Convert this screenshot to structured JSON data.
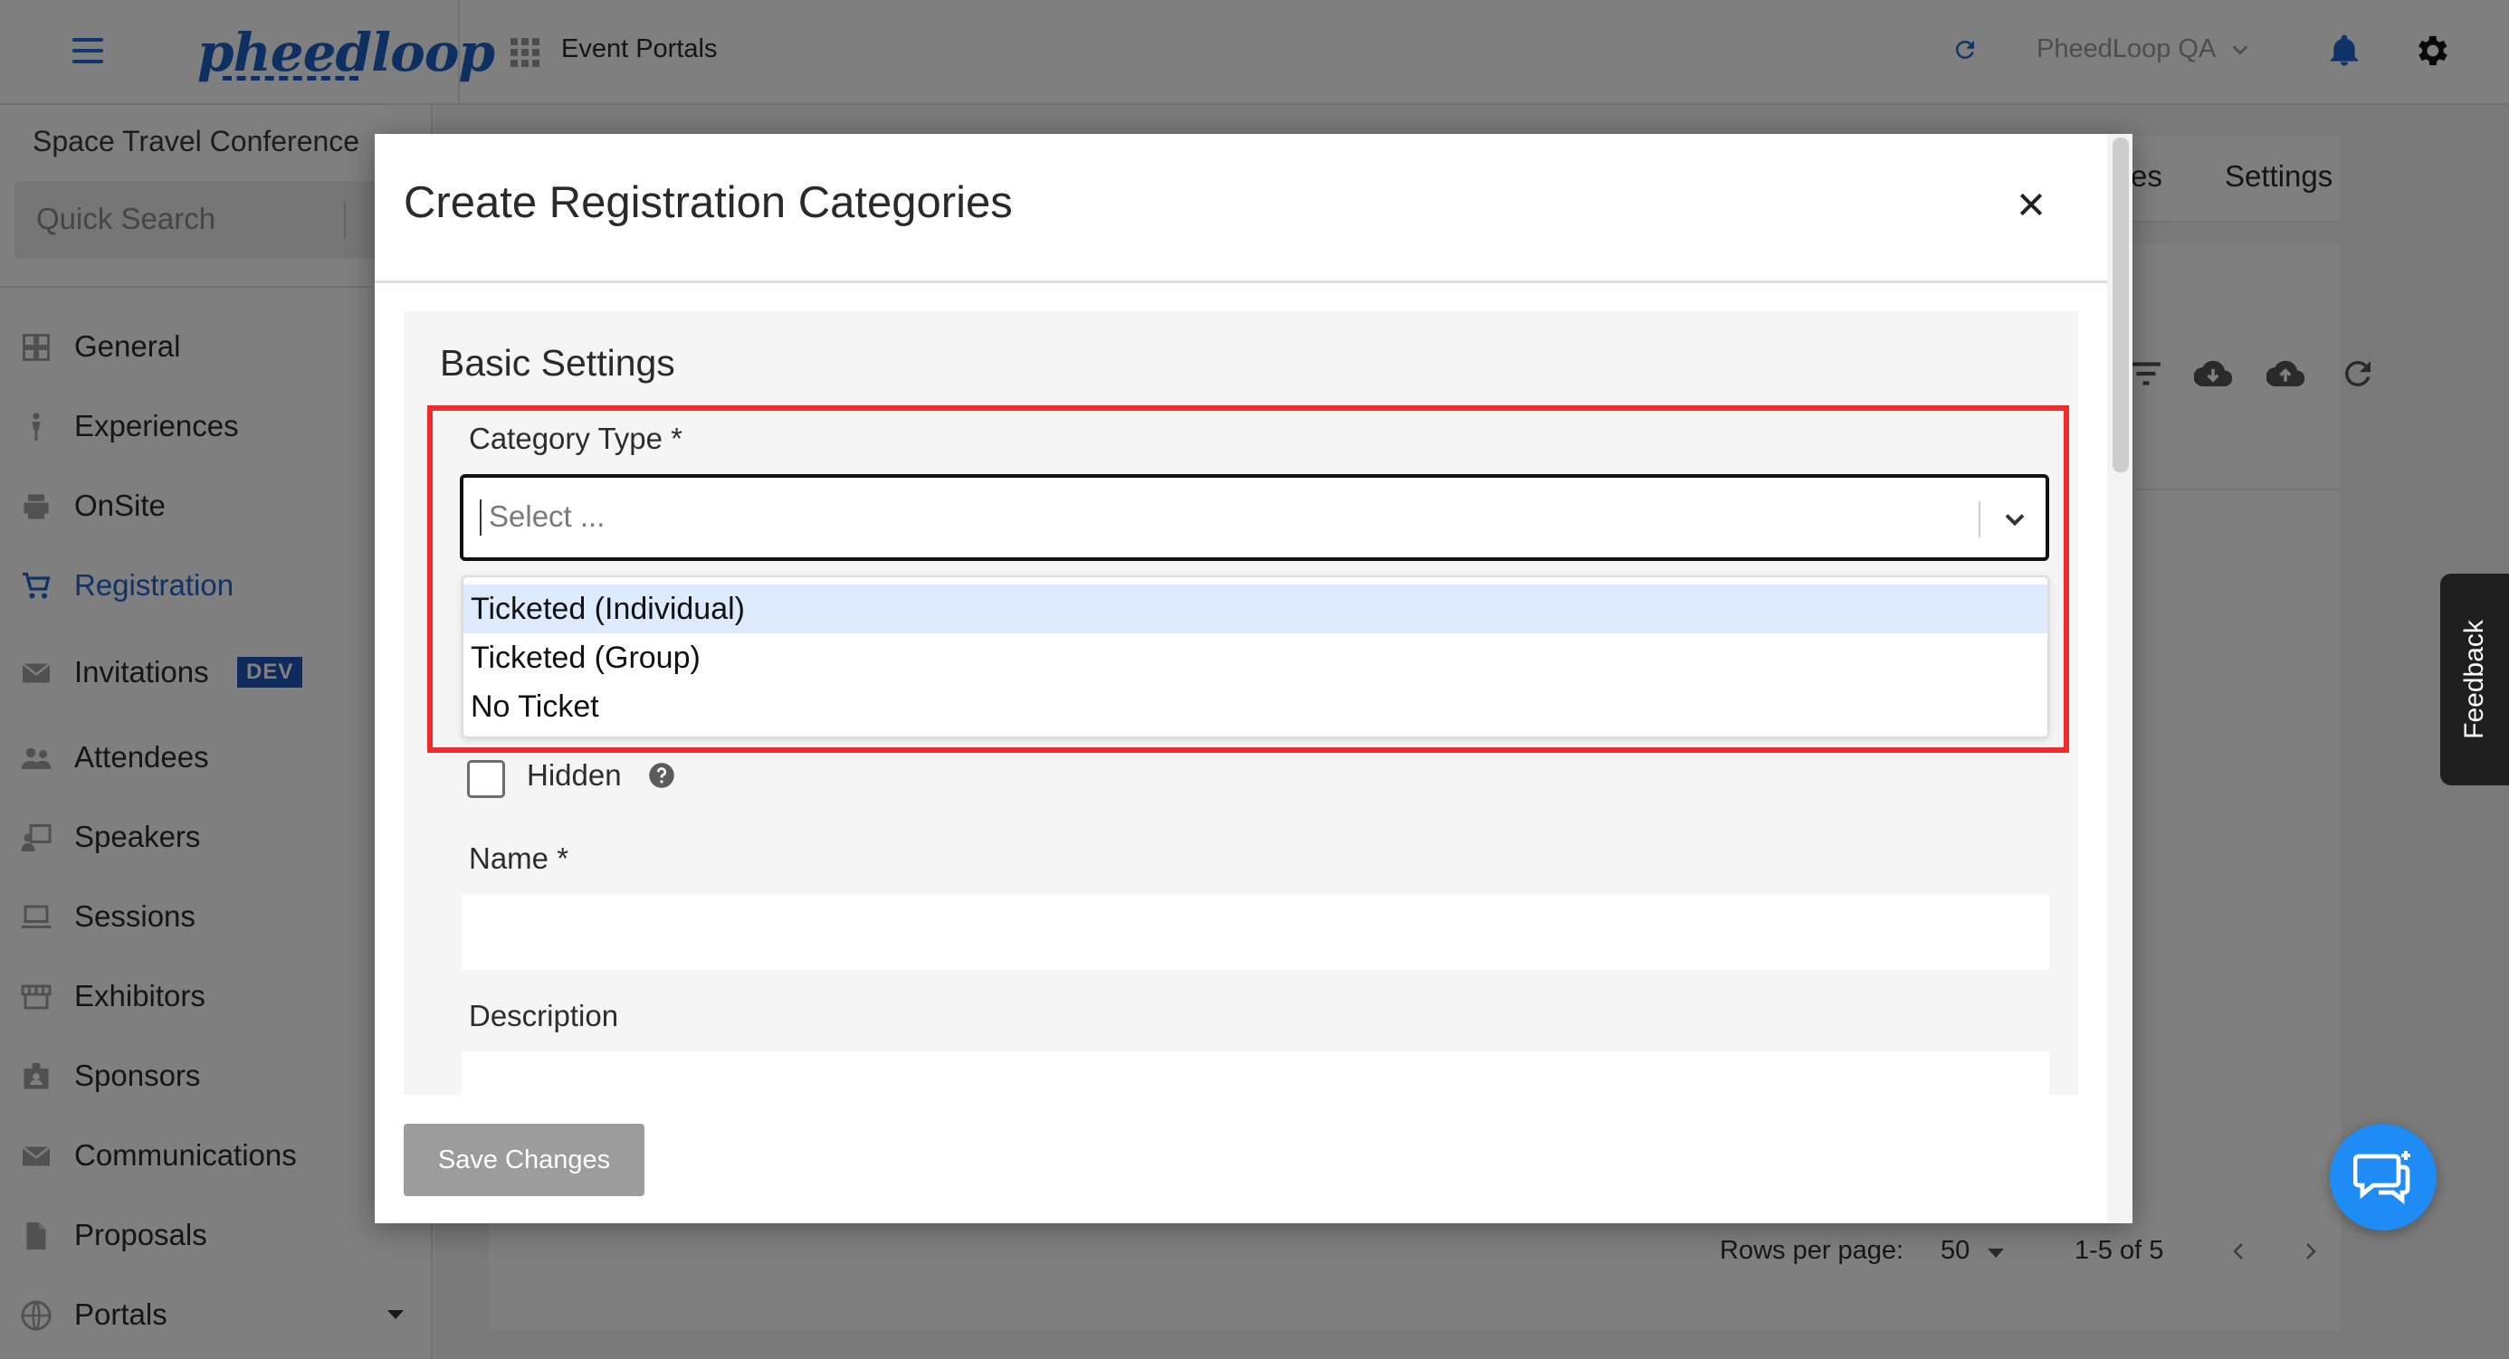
{
  "app": {
    "logo_text": "pheedloop",
    "nav_title": "Event Portals",
    "account": "PheedLoop QA"
  },
  "sidebar": {
    "event_name": "Space Travel Conference",
    "search_placeholder": "Quick Search",
    "items": [
      {
        "label": "General",
        "icon": "dashboard-icon"
      },
      {
        "label": "Experiences",
        "icon": "person-icon"
      },
      {
        "label": "OnSite",
        "icon": "printer-icon"
      },
      {
        "label": "Registration",
        "icon": "cart-icon",
        "active": true
      },
      {
        "label": "Invitations",
        "icon": "mail-icon",
        "badge": "DEV"
      },
      {
        "label": "Attendees",
        "icon": "people-icon"
      },
      {
        "label": "Speakers",
        "icon": "presenter-icon"
      },
      {
        "label": "Sessions",
        "icon": "laptop-icon"
      },
      {
        "label": "Exhibitors",
        "icon": "store-icon"
      },
      {
        "label": "Sponsors",
        "icon": "badge-icon"
      },
      {
        "label": "Communications",
        "icon": "mail-icon"
      },
      {
        "label": "Proposals",
        "icon": "document-icon"
      },
      {
        "label": "Portals",
        "icon": "globe-icon"
      }
    ]
  },
  "main": {
    "tab_partial": "es",
    "tab_settings": "Settings",
    "rows_per_page_label": "Rows per page:",
    "rows_per_page_value": "50",
    "range": "1-5 of 5"
  },
  "modal": {
    "title": "Create Registration Categories",
    "section_title": "Basic Settings",
    "category_type_label": "Category Type *",
    "category_type_placeholder": "Select ...",
    "category_options": [
      "Ticketed (Individual)",
      "Ticketed (Group)",
      "No Ticket"
    ],
    "hidden_label": "Hidden",
    "name_label": "Name *",
    "description_label": "Description",
    "save_label": "Save Changes"
  },
  "feedback_label": "Feedback",
  "colors": {
    "accent": "#1f66cc",
    "highlight": "#ef2b2b",
    "option_highlight": "#deebff",
    "save_disabled": "#9c9c9c",
    "chat": "#1f8bf5"
  }
}
